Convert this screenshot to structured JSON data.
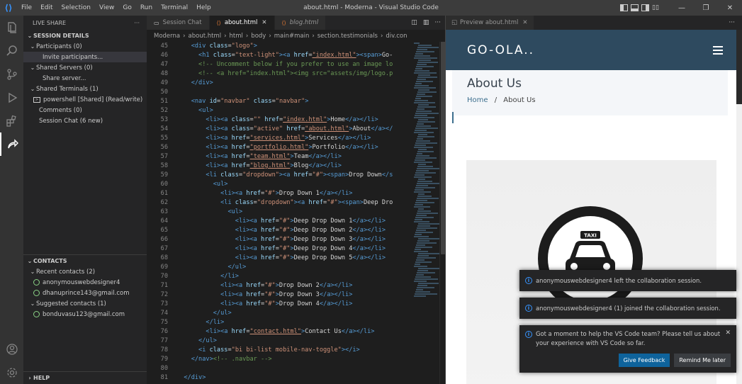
{
  "window": {
    "title": "about.html - Moderna - Visual Studio Code",
    "menu": [
      "File",
      "Edit",
      "Selection",
      "View",
      "Go",
      "Run",
      "Terminal",
      "Help"
    ]
  },
  "sidebar": {
    "header": "LIVE SHARE",
    "session_details": "SESSION DETAILS",
    "participants": "Participants (0)",
    "invite": "Invite participants...",
    "shared_servers": "Shared Servers (0)",
    "share_server": "Share server...",
    "shared_terminals": "Shared Terminals (1)",
    "terminal": "powershell [Shared] (Read/write)",
    "comments": "Comments (0)",
    "session_chat": "Session Chat (6 new)",
    "contacts": "CONTACTS",
    "recent_contacts": "Recent contacts (2)",
    "recent": [
      "anonymouswebdesigner4",
      "dhanuprince143@gmail.com"
    ],
    "suggested_contacts": "Suggested contacts (1)",
    "suggested": [
      "bonduvasu123@gmail.com"
    ],
    "help": "HELP"
  },
  "editor": {
    "tabs": [
      {
        "label": "Session Chat"
      },
      {
        "label": "about.html"
      },
      {
        "label": "blog.html"
      }
    ],
    "breadcrumb": [
      "Moderna",
      "about.html",
      "html",
      "body",
      "main#main",
      "section.testimonials",
      "div.con"
    ],
    "lines": [
      {
        "n": "45",
        "indent": "    ",
        "parts": [
          [
            "tg",
            "<div "
          ],
          [
            "at",
            "class"
          ],
          [
            "tx",
            "="
          ],
          [
            "st",
            "\"logo\""
          ],
          [
            "tg",
            ">"
          ]
        ]
      },
      {
        "n": "46",
        "indent": "      ",
        "parts": [
          [
            "tg",
            "<h1 "
          ],
          [
            "at",
            "class"
          ],
          [
            "tx",
            "="
          ],
          [
            "st",
            "\"text-light\""
          ],
          [
            "tg",
            "><a "
          ],
          [
            "at",
            "href"
          ],
          [
            "tx",
            "="
          ],
          [
            "st",
            "\"index.html\""
          ],
          [
            "tg",
            "><span>"
          ],
          [
            "tx",
            "Go-"
          ]
        ]
      },
      {
        "n": "47",
        "indent": "      ",
        "parts": [
          [
            "cm",
            "<!-- Uncomment below if you prefer to use an image lo"
          ]
        ]
      },
      {
        "n": "48",
        "indent": "      ",
        "parts": [
          [
            "cm",
            "<!-- <a href=\"index.html\"><img src=\"assets/img/logo.p"
          ]
        ]
      },
      {
        "n": "49",
        "indent": "    ",
        "parts": [
          [
            "tg",
            "</div>"
          ]
        ]
      },
      {
        "n": "50",
        "indent": "",
        "parts": []
      },
      {
        "n": "51",
        "indent": "    ",
        "parts": [
          [
            "tg",
            "<nav "
          ],
          [
            "at",
            "id"
          ],
          [
            "tx",
            "="
          ],
          [
            "st",
            "\"navbar\""
          ],
          [
            "tx",
            " "
          ],
          [
            "at",
            "class"
          ],
          [
            "tx",
            "="
          ],
          [
            "st",
            "\"navbar\""
          ],
          [
            "tg",
            ">"
          ]
        ]
      },
      {
        "n": "52",
        "indent": "      ",
        "parts": [
          [
            "tg",
            "<ul>"
          ]
        ]
      },
      {
        "n": "53",
        "indent": "        ",
        "parts": [
          [
            "tg",
            "<li><a "
          ],
          [
            "at",
            "class"
          ],
          [
            "tx",
            "="
          ],
          [
            "st",
            "\"\""
          ],
          [
            "tx",
            " "
          ],
          [
            "at",
            "href"
          ],
          [
            "tx",
            "="
          ],
          [
            "st",
            "\"index.html\""
          ],
          [
            "tg",
            ">"
          ],
          [
            "tx",
            "Home"
          ],
          [
            "tg",
            "</a></li>"
          ]
        ]
      },
      {
        "n": "54",
        "indent": "        ",
        "parts": [
          [
            "tg",
            "<li><a "
          ],
          [
            "at",
            "class"
          ],
          [
            "tx",
            "="
          ],
          [
            "st",
            "\"active\""
          ],
          [
            "tx",
            " "
          ],
          [
            "at",
            "href"
          ],
          [
            "tx",
            "="
          ],
          [
            "st",
            "\"about.html\""
          ],
          [
            "tg",
            ">"
          ],
          [
            "tx",
            "About"
          ],
          [
            "tg",
            "</a></"
          ]
        ]
      },
      {
        "n": "55",
        "indent": "        ",
        "parts": [
          [
            "tg",
            "<li><a "
          ],
          [
            "at",
            "href"
          ],
          [
            "tx",
            "="
          ],
          [
            "st",
            "\"services.html\""
          ],
          [
            "tg",
            ">"
          ],
          [
            "tx",
            "Services"
          ],
          [
            "tg",
            "</a></li>"
          ]
        ]
      },
      {
        "n": "56",
        "indent": "        ",
        "parts": [
          [
            "tg",
            "<li><a "
          ],
          [
            "at",
            "href"
          ],
          [
            "tx",
            "="
          ],
          [
            "st",
            "\"portfolio.html\""
          ],
          [
            "tg",
            ">"
          ],
          [
            "tx",
            "Portfolio"
          ],
          [
            "tg",
            "</a></li>"
          ]
        ]
      },
      {
        "n": "57",
        "indent": "        ",
        "parts": [
          [
            "tg",
            "<li><a "
          ],
          [
            "at",
            "href"
          ],
          [
            "tx",
            "="
          ],
          [
            "st",
            "\"team.html\""
          ],
          [
            "tg",
            ">"
          ],
          [
            "tx",
            "Team"
          ],
          [
            "tg",
            "</a></li>"
          ]
        ]
      },
      {
        "n": "58",
        "indent": "        ",
        "parts": [
          [
            "tg",
            "<li><a "
          ],
          [
            "at",
            "href"
          ],
          [
            "tx",
            "="
          ],
          [
            "st",
            "\"blog.html\""
          ],
          [
            "tg",
            ">"
          ],
          [
            "tx",
            "Blog"
          ],
          [
            "tg",
            "</a></li>"
          ]
        ]
      },
      {
        "n": "59",
        "indent": "        ",
        "parts": [
          [
            "tg",
            "<li "
          ],
          [
            "at",
            "class"
          ],
          [
            "tx",
            "="
          ],
          [
            "st",
            "\"dropdown\""
          ],
          [
            "tg",
            "><a "
          ],
          [
            "at",
            "href"
          ],
          [
            "tx",
            "="
          ],
          [
            "st",
            "\"#\""
          ],
          [
            "tg",
            "><span>"
          ],
          [
            "tx",
            "Drop Down"
          ],
          [
            "tg",
            "</s"
          ]
        ]
      },
      {
        "n": "60",
        "indent": "          ",
        "parts": [
          [
            "tg",
            "<ul>"
          ]
        ]
      },
      {
        "n": "61",
        "indent": "            ",
        "parts": [
          [
            "tg",
            "<li><a "
          ],
          [
            "at",
            "href"
          ],
          [
            "tx",
            "="
          ],
          [
            "st",
            "\"#\""
          ],
          [
            "tg",
            ">"
          ],
          [
            "tx",
            "Drop Down 1"
          ],
          [
            "tg",
            "</a></li>"
          ]
        ]
      },
      {
        "n": "62",
        "indent": "            ",
        "parts": [
          [
            "tg",
            "<li "
          ],
          [
            "at",
            "class"
          ],
          [
            "tx",
            "="
          ],
          [
            "st",
            "\"dropdown\""
          ],
          [
            "tg",
            "><a "
          ],
          [
            "at",
            "href"
          ],
          [
            "tx",
            "="
          ],
          [
            "st",
            "\"#\""
          ],
          [
            "tg",
            "><span>"
          ],
          [
            "tx",
            "Deep Dro"
          ]
        ]
      },
      {
        "n": "63",
        "indent": "              ",
        "parts": [
          [
            "tg",
            "<ul>"
          ]
        ]
      },
      {
        "n": "64",
        "indent": "                ",
        "parts": [
          [
            "tg",
            "<li><a "
          ],
          [
            "at",
            "href"
          ],
          [
            "tx",
            "="
          ],
          [
            "st",
            "\"#\""
          ],
          [
            "tg",
            ">"
          ],
          [
            "tx",
            "Deep Drop Down 1"
          ],
          [
            "tg",
            "</a></li>"
          ]
        ]
      },
      {
        "n": "65",
        "indent": "                ",
        "parts": [
          [
            "tg",
            "<li><a "
          ],
          [
            "at",
            "href"
          ],
          [
            "tx",
            "="
          ],
          [
            "st",
            "\"#\""
          ],
          [
            "tg",
            ">"
          ],
          [
            "tx",
            "Deep Drop Down 2"
          ],
          [
            "tg",
            "</a></li>"
          ]
        ]
      },
      {
        "n": "66",
        "indent": "                ",
        "parts": [
          [
            "tg",
            "<li><a "
          ],
          [
            "at",
            "href"
          ],
          [
            "tx",
            "="
          ],
          [
            "st",
            "\"#\""
          ],
          [
            "tg",
            ">"
          ],
          [
            "tx",
            "Deep Drop Down 3"
          ],
          [
            "tg",
            "</a></li>"
          ]
        ]
      },
      {
        "n": "67",
        "indent": "                ",
        "parts": [
          [
            "tg",
            "<li><a "
          ],
          [
            "at",
            "href"
          ],
          [
            "tx",
            "="
          ],
          [
            "st",
            "\"#\""
          ],
          [
            "tg",
            ">"
          ],
          [
            "tx",
            "Deep Drop Down 4"
          ],
          [
            "tg",
            "</a></li>"
          ]
        ]
      },
      {
        "n": "68",
        "indent": "                ",
        "parts": [
          [
            "tg",
            "<li><a "
          ],
          [
            "at",
            "href"
          ],
          [
            "tx",
            "="
          ],
          [
            "st",
            "\"#\""
          ],
          [
            "tg",
            ">"
          ],
          [
            "tx",
            "Deep Drop Down 5"
          ],
          [
            "tg",
            "</a></li>"
          ]
        ]
      },
      {
        "n": "69",
        "indent": "              ",
        "parts": [
          [
            "tg",
            "</ul>"
          ]
        ]
      },
      {
        "n": "70",
        "indent": "            ",
        "parts": [
          [
            "tg",
            "</li>"
          ]
        ]
      },
      {
        "n": "71",
        "indent": "            ",
        "parts": [
          [
            "tg",
            "<li><a "
          ],
          [
            "at",
            "href"
          ],
          [
            "tx",
            "="
          ],
          [
            "st",
            "\"#\""
          ],
          [
            "tg",
            ">"
          ],
          [
            "tx",
            "Drop Down 2"
          ],
          [
            "tg",
            "</a></li>"
          ]
        ]
      },
      {
        "n": "72",
        "indent": "            ",
        "parts": [
          [
            "tg",
            "<li><a "
          ],
          [
            "at",
            "href"
          ],
          [
            "tx",
            "="
          ],
          [
            "st",
            "\"#\""
          ],
          [
            "tg",
            ">"
          ],
          [
            "tx",
            "Drop Down 3"
          ],
          [
            "tg",
            "</a></li>"
          ]
        ]
      },
      {
        "n": "73",
        "indent": "            ",
        "parts": [
          [
            "tg",
            "<li><a "
          ],
          [
            "at",
            "href"
          ],
          [
            "tx",
            "="
          ],
          [
            "st",
            "\"#\""
          ],
          [
            "tg",
            ">"
          ],
          [
            "tx",
            "Drop Down 4"
          ],
          [
            "tg",
            "</a></li>"
          ]
        ]
      },
      {
        "n": "74",
        "indent": "          ",
        "parts": [
          [
            "tg",
            "</ul>"
          ]
        ]
      },
      {
        "n": "75",
        "indent": "        ",
        "parts": [
          [
            "tg",
            "</li>"
          ]
        ]
      },
      {
        "n": "76",
        "indent": "        ",
        "parts": [
          [
            "tg",
            "<li><a "
          ],
          [
            "at",
            "href"
          ],
          [
            "tx",
            "="
          ],
          [
            "st",
            "\"contact.html\""
          ],
          [
            "tg",
            ">"
          ],
          [
            "tx",
            "Contact Us"
          ],
          [
            "tg",
            "</a></li>"
          ]
        ]
      },
      {
        "n": "77",
        "indent": "      ",
        "parts": [
          [
            "tg",
            "</ul>"
          ]
        ]
      },
      {
        "n": "78",
        "indent": "      ",
        "parts": [
          [
            "tg",
            "<i "
          ],
          [
            "at",
            "class"
          ],
          [
            "tx",
            "="
          ],
          [
            "st",
            "\"bi bi-list mobile-nav-toggle\""
          ],
          [
            "tg",
            "></i>"
          ]
        ]
      },
      {
        "n": "79",
        "indent": "    ",
        "parts": [
          [
            "tg",
            "</nav>"
          ],
          [
            "cm",
            "<!-- .navbar -->"
          ]
        ]
      },
      {
        "n": "80",
        "indent": "",
        "parts": []
      },
      {
        "n": "81",
        "indent": "  ",
        "parts": [
          [
            "tg",
            "</div>"
          ]
        ]
      }
    ]
  },
  "preview": {
    "tab": "Preview about.html",
    "logo": "GO-OLA..",
    "page_title": "About Us",
    "crumb_home": "Home",
    "crumb_sep": "/",
    "crumb_current": "About Us",
    "taxi_sign": "TAXI"
  },
  "notifications": {
    "left": "anonymouswebdesigner4 left the collaboration session.",
    "joined": "anonymouswebdesigner4 (1) joined the collaboration session.",
    "survey": "Got a moment to help the VS Code team? Please tell us about your experience with VS Code so far.",
    "give_feedback": "Give Feedback",
    "remind_later": "Remind Me later"
  },
  "colors": {
    "accent": "#3794ff",
    "site_header": "#2e4a5f",
    "button_primary": "#0e639c"
  }
}
